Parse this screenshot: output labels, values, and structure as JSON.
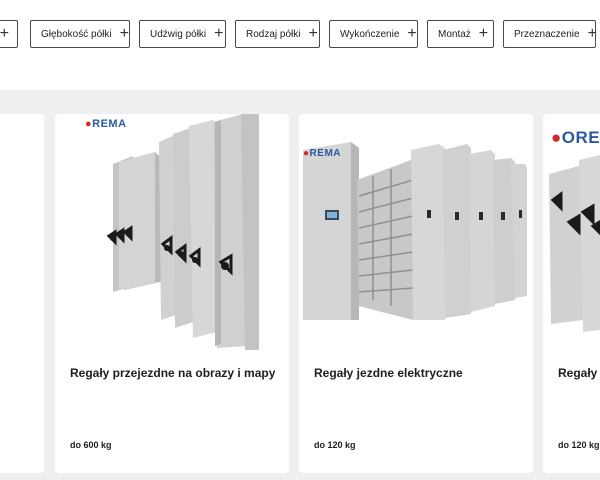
{
  "filters": [
    {
      "label": "Głębokość półki"
    },
    {
      "label": "Udźwig półki"
    },
    {
      "label": "Rodzaj półki"
    },
    {
      "label": "Wykończenie"
    },
    {
      "label": "Montaż"
    },
    {
      "label": "Przeznaczenie"
    }
  ],
  "filter_icon": "plus-icon",
  "filter_plus_glyph": "+",
  "products": [
    {
      "title": "Regały przejezdne na obrazy i mapy",
      "capacity": "do 600 kg",
      "logo": "REMA"
    },
    {
      "title": "Regały jezdne elektryczne",
      "capacity": "do 120 kg",
      "logo": "REMA"
    },
    {
      "title": "Regały p",
      "capacity": "do 120 kg",
      "logo": "ORE"
    }
  ],
  "colors": {
    "background": "#efefef",
    "card": "#ffffff",
    "cabinet": "#cfd0d0",
    "brand_blue": "#2c5aa0",
    "brand_red": "#d42a2a"
  }
}
